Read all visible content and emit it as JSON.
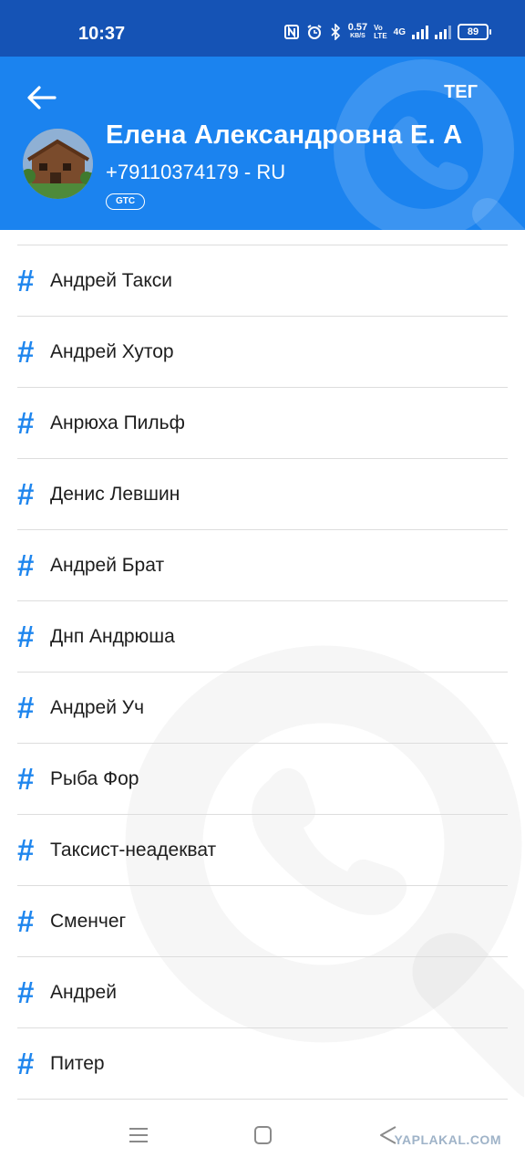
{
  "status_bar": {
    "time": "10:37",
    "speed_value": "0.57",
    "speed_unit": "KB/S",
    "volte_top": "Vo",
    "volte_bottom": "LTE",
    "network": "4G",
    "battery": "89"
  },
  "header": {
    "right_action": "ТЕГ",
    "contact_name": "Елена Александровна Е. А",
    "contact_phone": "+79110374179 - RU",
    "badge": "GTC"
  },
  "tags": [
    "Андрей Такси",
    "Андрей Хутор",
    "Анрюха Пильф",
    "Денис Левшин",
    "Андрей Брат",
    "Днп Андрюша",
    "Андрей Уч",
    "Рыба Фор",
    "Таксист-неадекват",
    "Сменчег",
    "Андрей",
    "Питер"
  ],
  "footer_watermark": "YAPLAKAL.COM",
  "colors": {
    "status_bar": "#1553b5",
    "header": "#1b83ef",
    "hash_icon": "#1f86ee"
  }
}
